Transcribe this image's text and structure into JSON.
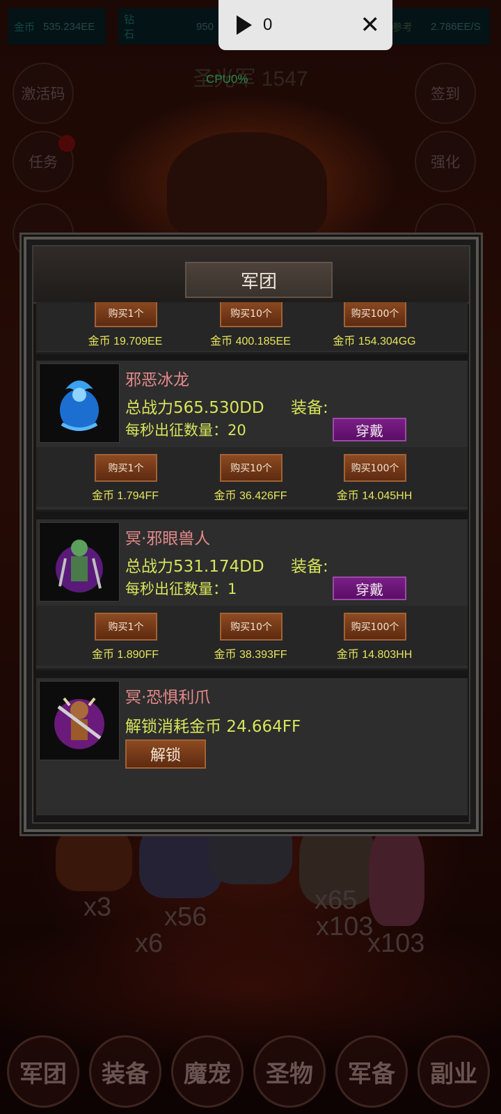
{
  "top_bar": {
    "gold": {
      "label": "金币",
      "value": "535.234EE"
    },
    "diamond": {
      "label": "钻石",
      "value": "950"
    },
    "income": {
      "label": "益参考",
      "value": "2.786EE/S"
    }
  },
  "recording": {
    "count": "0"
  },
  "boss_title": "圣光军 1547",
  "cpu_text": "CPU0%",
  "side_buttons": {
    "left": [
      "激活码",
      "任务"
    ],
    "right": [
      "签到",
      "强化"
    ]
  },
  "dialog": {
    "title": "军团",
    "top_partial_row": {
      "buttons": [
        "购买1个",
        "购买10个",
        "购买100个"
      ],
      "prices": [
        "金币 19.709EE",
        "金币 400.185EE",
        "金币 154.304GG"
      ]
    },
    "units": [
      {
        "name": "邪恶冰龙",
        "power": "总战力565.530DD",
        "equip_label": "装备:",
        "rate": "每秒出征数量：20",
        "equip_button": "穿戴",
        "buttons": [
          "购买1个",
          "购买10个",
          "购买100个"
        ],
        "prices": [
          "金币 1.794FF",
          "金币 36.426FF",
          "金币 14.045HH"
        ],
        "icon": "ice-dragon-icon"
      },
      {
        "name": "冥·邪眼兽人",
        "power": "总战力531.174DD",
        "equip_label": "装备:",
        "rate": "每秒出征数量：1",
        "equip_button": "穿戴",
        "buttons": [
          "购买1个",
          "购买10个",
          "购买100个"
        ],
        "prices": [
          "金币 1.890FF",
          "金币 38.393FF",
          "金币 14.803HH"
        ],
        "icon": "evil-eye-orc-icon"
      }
    ],
    "locked_unit": {
      "name": "冥·恐惧利爪",
      "unlock_cost": "解锁消耗金币 24.664FF",
      "unlock_button": "解锁",
      "icon": "dread-claw-minotaur-icon"
    }
  },
  "scene_multipliers": [
    "x3",
    "x56",
    "x6",
    "x65",
    "x103",
    "x103"
  ],
  "bottom_nav": [
    "军团",
    "装备",
    "魔宠",
    "圣物",
    "军备",
    "副业"
  ],
  "colors": {
    "price_text": "#e6e45c",
    "unit_name": "#e58a8a",
    "wear_button": "#6a1a78",
    "buy_button": "#7a3c1a"
  }
}
